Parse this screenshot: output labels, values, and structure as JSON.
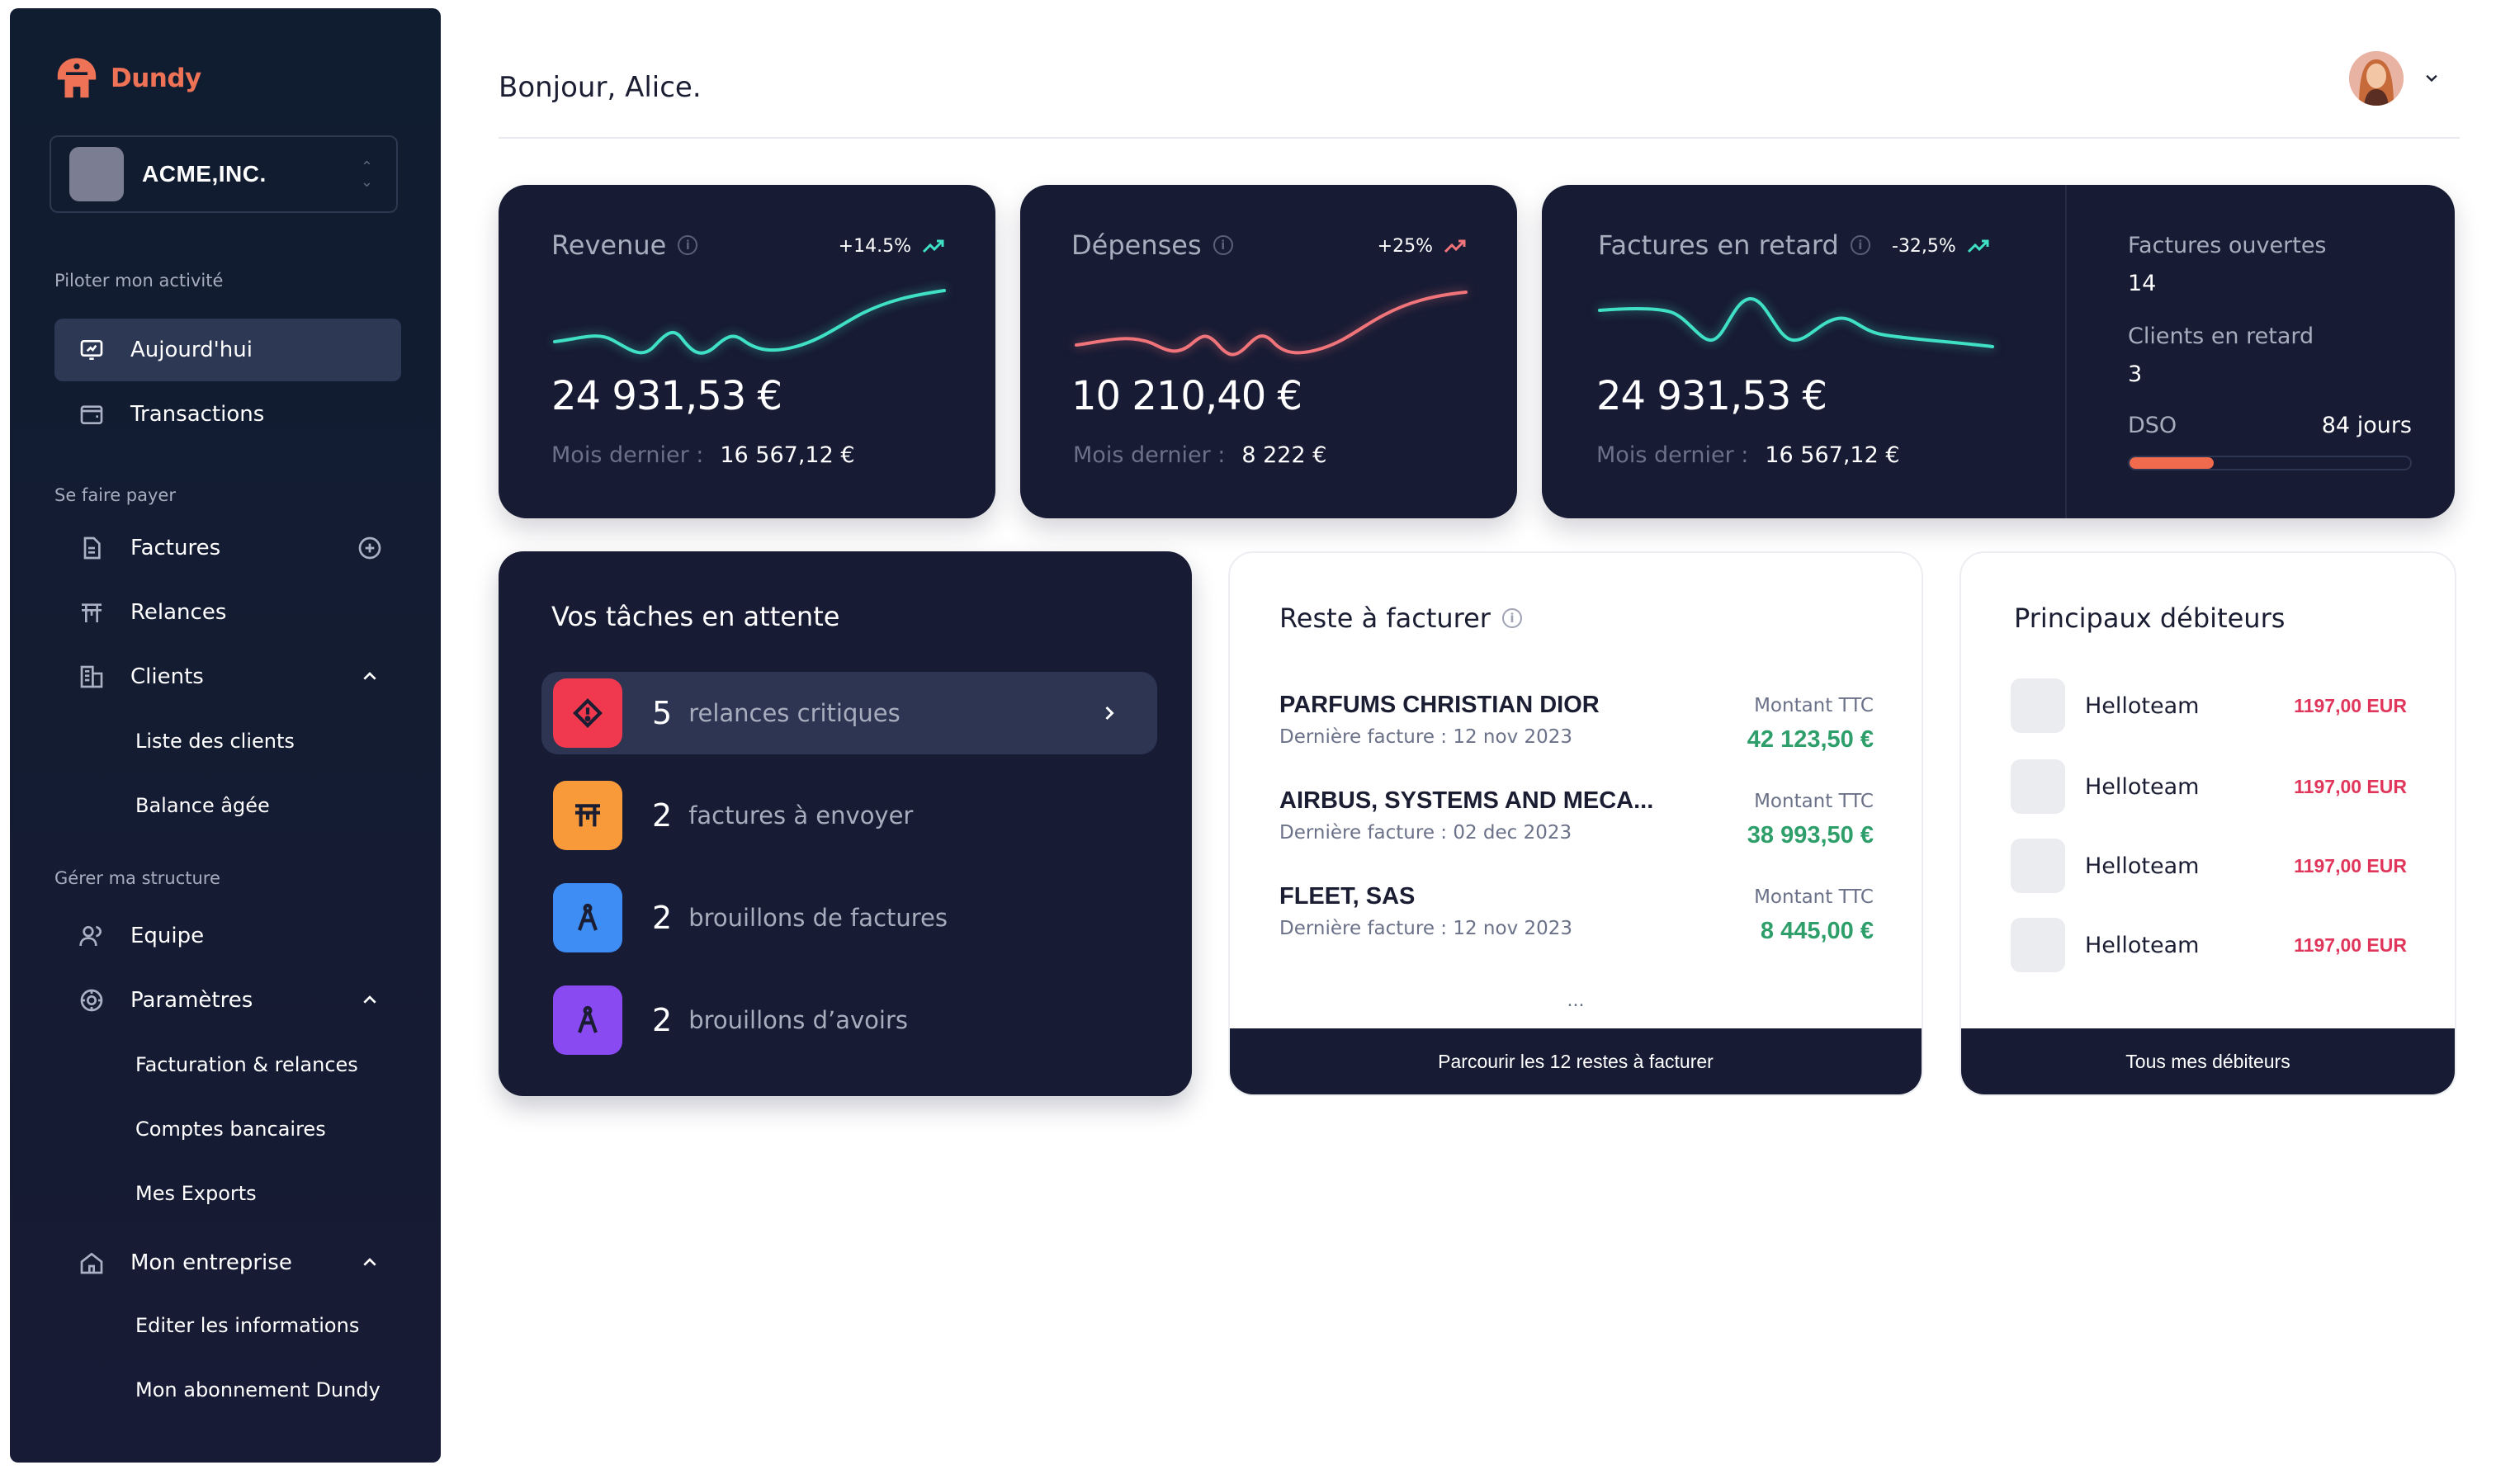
{
  "brand": {
    "name": "Dundy",
    "accent": "#ee7356"
  },
  "company": {
    "name": "ACME,INC."
  },
  "sidebar": {
    "sections": [
      {
        "title": "Piloter mon activité"
      },
      {
        "title": "Se faire payer"
      },
      {
        "title": "Gérer ma structure"
      }
    ],
    "items": {
      "today": "Aujourd'hui",
      "transactions": "Transactions",
      "invoices": "Factures",
      "reminders": "Relances",
      "clients": "Clients",
      "clients_list": "Liste des clients",
      "aged_balance": "Balance âgée",
      "team": "Equipe",
      "settings": "Paramètres",
      "billing_reminders": "Facturation & relances",
      "bank_accounts": "Comptes bancaires",
      "exports": "Mes Exports",
      "my_company": "Mon entreprise",
      "edit_info": "Editer les informations",
      "subscription": "Mon abonnement Dundy"
    }
  },
  "header": {
    "greeting": "Bonjour, Alice."
  },
  "kpis": {
    "revenue": {
      "title": "Revenue",
      "delta": "+14.5%",
      "value": "24 931,53 €",
      "last_label": "Mois dernier :",
      "last_value": "16 567,12 €",
      "color": "#3fe0c5"
    },
    "expenses": {
      "title": "Dépenses",
      "delta": "+25%",
      "value": "10 210,40 €",
      "last_label": "Mois dernier :",
      "last_value": "8 222 €",
      "color": "#f0747a"
    },
    "overdue": {
      "title": "Factures en retard",
      "delta": "-32,5%",
      "value": "24 931,53 €",
      "last_label": "Mois dernier :",
      "last_value": "16 567,12 €",
      "color": "#3fe0c5"
    },
    "side": {
      "open_label": "Factures ouvertes",
      "open_value": "14",
      "late_clients_label": "Clients en retard",
      "late_clients_value": "3",
      "dso_label": "DSO",
      "dso_value": "84 jours",
      "dso_progress": 0.3
    }
  },
  "tasks": {
    "title": "Vos tâches en attente",
    "items": [
      {
        "count": "5",
        "label": "relances critiques",
        "color": "#f0384f"
      },
      {
        "count": "2",
        "label": "factures à envoyer",
        "color": "#f99a3a"
      },
      {
        "count": "2",
        "label": "brouillons de factures",
        "color": "#3e8df5"
      },
      {
        "count": "2",
        "label": "brouillons d’avoirs",
        "color": "#8a4af2"
      }
    ]
  },
  "to_invoice": {
    "title": "Reste à facturer",
    "items": [
      {
        "name": "PARFUMS CHRISTIAN DIOR",
        "date": "Dernière facture : 12 nov 2023",
        "amount_label": "Montant TTC",
        "amount": "42 123,50 €"
      },
      {
        "name": "AIRBUS, SYSTEMS AND MECA...",
        "date": "Dernière facture : 02 dec 2023",
        "amount_label": "Montant TTC",
        "amount": "38 993,50 €"
      },
      {
        "name": "FLEET, SAS",
        "date": "Dernière facture : 12 nov 2023",
        "amount_label": "Montant TTC",
        "amount": "8 445,00 €"
      }
    ],
    "more": "...",
    "footer": "Parcourir les 12 restes à facturer"
  },
  "debtors": {
    "title": "Principaux débiteurs",
    "items": [
      {
        "name": "Helloteam",
        "amount": "1197,00 EUR"
      },
      {
        "name": "Helloteam",
        "amount": "1197,00 EUR"
      },
      {
        "name": "Helloteam",
        "amount": "1197,00 EUR"
      },
      {
        "name": "Helloteam",
        "amount": "1197,00 EUR"
      }
    ],
    "footer": "Tous mes débiteurs"
  }
}
